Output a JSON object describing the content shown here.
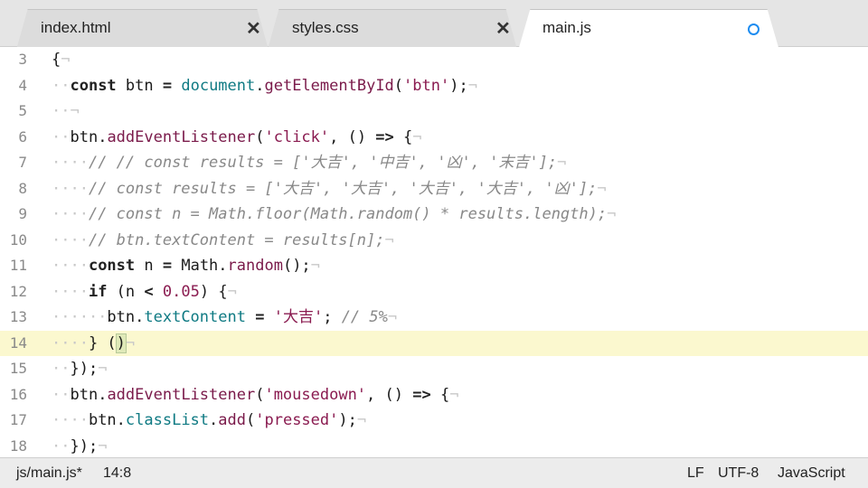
{
  "tabs": [
    {
      "label": "index.html",
      "close": "✕"
    },
    {
      "label": "styles.css",
      "close": "✕"
    },
    {
      "label": "main.js",
      "modified": true
    }
  ],
  "editor": {
    "lines": [
      {
        "n": "3",
        "code": "{¬"
      },
      {
        "n": "4",
        "code": "··const btn = document.getElementById('btn');¬"
      },
      {
        "n": "5",
        "code": "··¬"
      },
      {
        "n": "6",
        "code": "··btn.addEventListener('click', () => {¬"
      },
      {
        "n": "7",
        "code": "····// // const results = ['大吉', '中吉', '凶', '末吉'];¬"
      },
      {
        "n": "8",
        "code": "····// const results = ['大吉', '大吉', '大吉', '大吉', '凶'];¬"
      },
      {
        "n": "9",
        "code": "····// const n = Math.floor(Math.random() * results.length);¬"
      },
      {
        "n": "10",
        "code": "····// btn.textContent = results[n];¬"
      },
      {
        "n": "11",
        "code": "····const n = Math.random();¬"
      },
      {
        "n": "12",
        "code": "····if (n < 0.05) {¬"
      },
      {
        "n": "13",
        "code": "······btn.textContent = '大吉'; // 5%¬"
      },
      {
        "n": "14",
        "code": "····} ()¬"
      },
      {
        "n": "15",
        "code": "··});¬"
      },
      {
        "n": "16",
        "code": "··btn.addEventListener('mousedown', () => {¬"
      },
      {
        "n": "17",
        "code": "····btn.classList.add('pressed');¬"
      },
      {
        "n": "18",
        "code": "··});¬"
      }
    ]
  },
  "status": {
    "file": "js/main.js*",
    "position": "14:8",
    "line_ending": "LF",
    "encoding": "UTF-8",
    "language": "JavaScript"
  },
  "colors": {
    "accent": "#1d8cf0",
    "current_line": "#fbf8cf"
  }
}
